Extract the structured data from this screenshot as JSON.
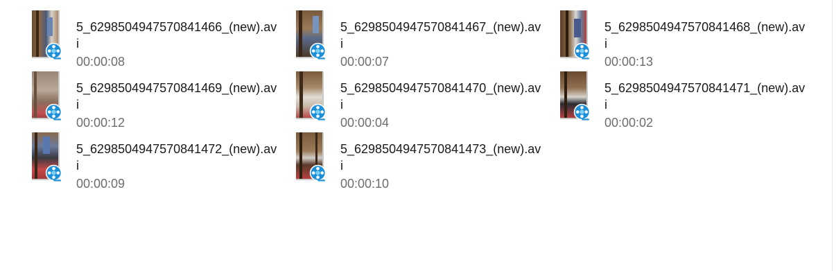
{
  "view": "content-view",
  "files": [
    {
      "name": "5_6298504947570841466_(new).avi",
      "duration": "00:00:08",
      "thumb_icon": "video-thumbnail",
      "badge_icon": "video-file-icon"
    },
    {
      "name": "5_6298504947570841467_(new).avi",
      "duration": "00:00:07",
      "thumb_icon": "video-thumbnail",
      "badge_icon": "video-file-icon"
    },
    {
      "name": "5_6298504947570841468_(new).avi",
      "duration": "00:00:13",
      "thumb_icon": "video-thumbnail",
      "badge_icon": "video-file-icon"
    },
    {
      "name": "5_6298504947570841469_(new).avi",
      "duration": "00:00:12",
      "thumb_icon": "video-thumbnail",
      "badge_icon": "video-file-icon"
    },
    {
      "name": "5_6298504947570841470_(new).avi",
      "duration": "00:00:04",
      "thumb_icon": "video-thumbnail",
      "badge_icon": "video-file-icon"
    },
    {
      "name": "5_6298504947570841471_(new).avi",
      "duration": "00:00:02",
      "thumb_icon": "video-thumbnail",
      "badge_icon": "video-file-icon"
    },
    {
      "name": "5_6298504947570841472_(new).avi",
      "duration": "00:00:09",
      "thumb_icon": "video-thumbnail",
      "badge_icon": "video-file-icon"
    },
    {
      "name": "5_6298504947570841473_(new).avi",
      "duration": "00:00:10",
      "thumb_icon": "video-thumbnail",
      "badge_icon": "video-file-icon"
    }
  ],
  "colors": {
    "name_text": "#1a1a1a",
    "duration_text": "#6d6d6d",
    "badge_blue": "#1e90d8",
    "badge_light": "#7fd0f5"
  }
}
